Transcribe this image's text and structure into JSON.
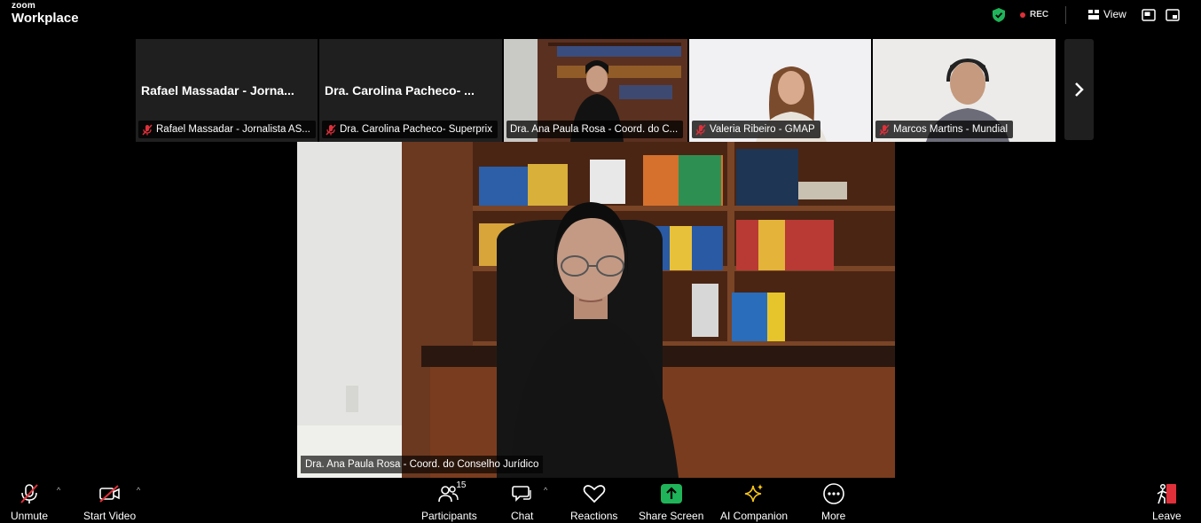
{
  "app": {
    "logo_top": "zoom",
    "logo_bottom": "Workplace"
  },
  "topbar": {
    "rec_label": "REC",
    "view_label": "View"
  },
  "participants_strip": [
    {
      "big_name": "Rafael Massadar - Jorna...",
      "label": "Rafael Massadar - Jornalista AS...",
      "muted": true
    },
    {
      "big_name": "Dra. Carolina Pacheco- ...",
      "label": "Dra. Carolina Pacheco- Superprix",
      "muted": true
    },
    {
      "label": "Dra. Ana Paula Rosa - Coord. do C...",
      "muted": false,
      "active": true
    },
    {
      "label": "Valeria Ribeiro - GMAP",
      "muted": true
    },
    {
      "label": "Marcos Martins - Mundial",
      "muted": true
    }
  ],
  "main_video": {
    "label": "Dra. Ana Paula Rosa - Coord. do Conselho Jurídico"
  },
  "toolbar": {
    "unmute": "Unmute",
    "start_video": "Start Video",
    "participants": "Participants",
    "participants_count": "15",
    "chat": "Chat",
    "reactions": "Reactions",
    "share_screen": "Share Screen",
    "ai_companion": "AI Companion",
    "more": "More",
    "leave": "Leave"
  },
  "colors": {
    "accent_green": "#20b45a",
    "muted_red": "#e0303a",
    "active_outline": "#d6e04a",
    "leave_red": "#e0303a"
  }
}
